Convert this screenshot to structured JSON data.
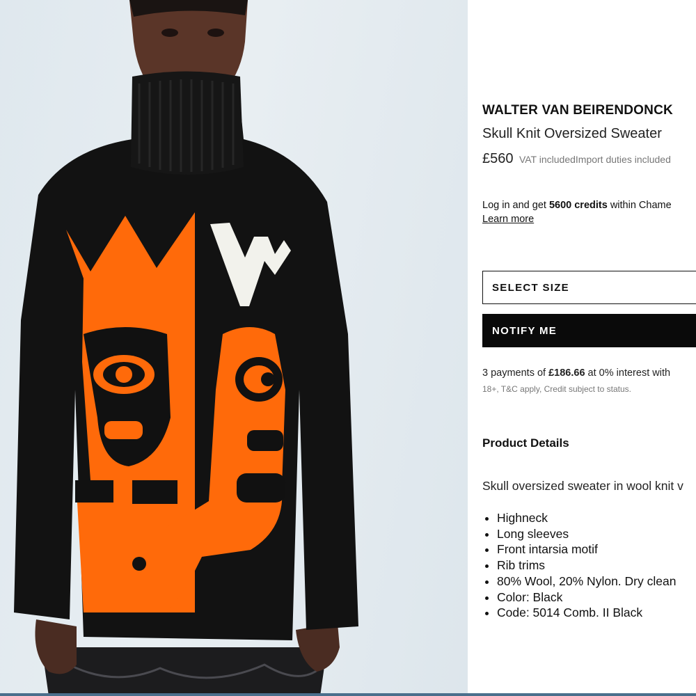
{
  "product": {
    "brand": "WALTER VAN BEIRENDONCK",
    "name": "Skull Knit Oversized Sweater",
    "price": "£560",
    "vat_note": "VAT includedImport duties included"
  },
  "credits": {
    "prefix": "Log in and get ",
    "amount": "5600 credits",
    "suffix": " within Chame",
    "learn_more": "Learn more"
  },
  "actions": {
    "select_size": "SELECT SIZE",
    "notify_me": "NOTIFY ME"
  },
  "payments": {
    "prefix": "3 payments of ",
    "amount": "£186.66",
    "suffix": " at 0% interest with",
    "small_print": "18+, T&C apply, Credit subject to status."
  },
  "details": {
    "heading": "Product Details",
    "description": "Skull oversized sweater in wool knit v",
    "features": [
      "Highneck",
      "Long sleeves",
      "Front intarsia motif",
      "Rib trims",
      "80% Wool, 20% Nylon. Dry clean",
      "Color: Black",
      "Code: 5014 Comb. II Black"
    ]
  },
  "image": {
    "alt_icon": "product-photo",
    "colors": {
      "sweater": "#111111",
      "motif": "#ff6a0a",
      "accent": "#f2f2ec"
    }
  }
}
